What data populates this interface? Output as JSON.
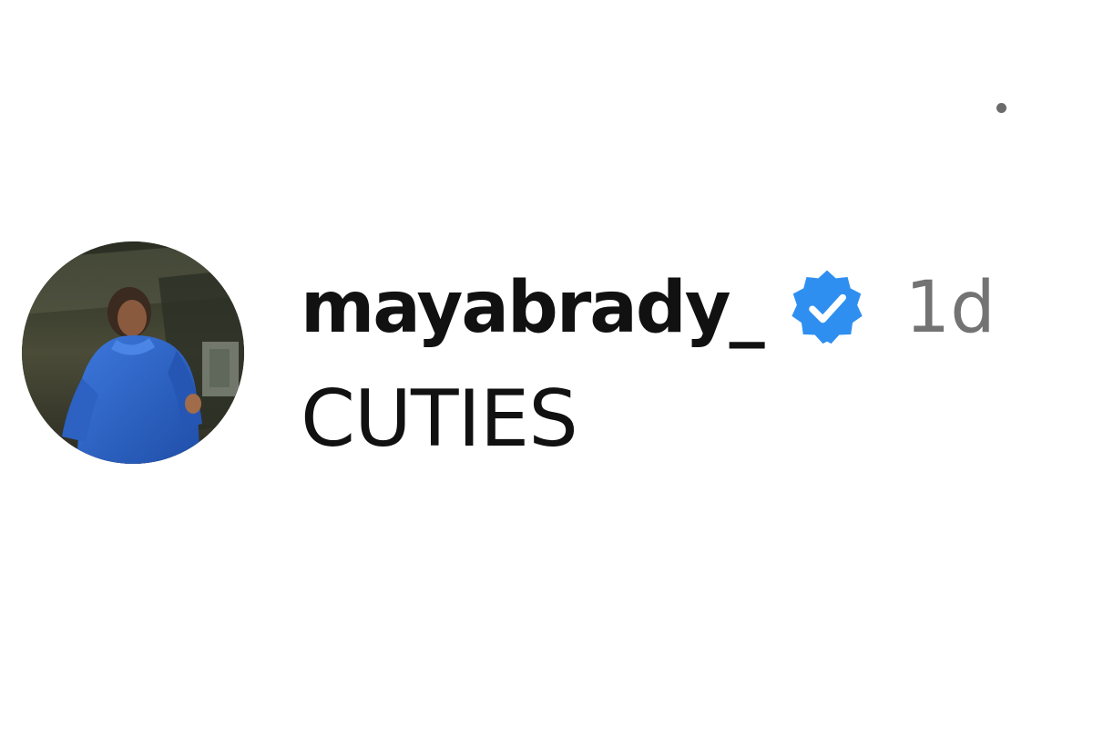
{
  "comment": {
    "username": "mayabrady_",
    "verified_icon": "verified-badge-icon",
    "time": "1d",
    "text": "CUTIES"
  },
  "colors": {
    "verified_blue": "#2f8ff0",
    "time_gray": "#737373",
    "text": "#111111",
    "avatar_jacket": "#2e63c9"
  }
}
